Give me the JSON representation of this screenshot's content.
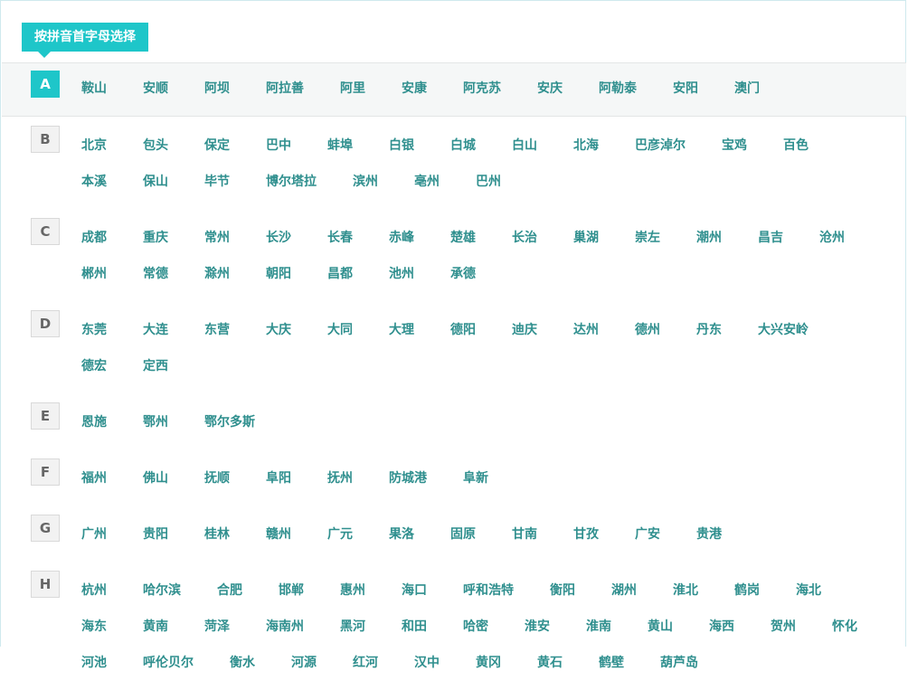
{
  "header": {
    "tab_label": "按拼音首字母选择"
  },
  "groups": [
    {
      "letter": "A",
      "active": true,
      "cities": [
        "鞍山",
        "安顺",
        "阿坝",
        "阿拉善",
        "阿里",
        "安康",
        "阿克苏",
        "安庆",
        "阿勒泰",
        "安阳",
        "澳门"
      ]
    },
    {
      "letter": "B",
      "active": false,
      "cities": [
        "北京",
        "包头",
        "保定",
        "巴中",
        "蚌埠",
        "白银",
        "白城",
        "白山",
        "北海",
        "巴彦淖尔",
        "宝鸡",
        "百色",
        "本溪",
        "保山",
        "毕节",
        "博尔塔拉",
        "滨州",
        "亳州",
        "巴州"
      ]
    },
    {
      "letter": "C",
      "active": false,
      "cities": [
        "成都",
        "重庆",
        "常州",
        "长沙",
        "长春",
        "赤峰",
        "楚雄",
        "长治",
        "巢湖",
        "崇左",
        "潮州",
        "昌吉",
        "沧州",
        "郴州",
        "常德",
        "滁州",
        "朝阳",
        "昌都",
        "池州",
        "承德"
      ]
    },
    {
      "letter": "D",
      "active": false,
      "cities": [
        "东莞",
        "大连",
        "东营",
        "大庆",
        "大同",
        "大理",
        "德阳",
        "迪庆",
        "达州",
        "德州",
        "丹东",
        "大兴安岭",
        "德宏",
        "定西"
      ]
    },
    {
      "letter": "E",
      "active": false,
      "cities": [
        "恩施",
        "鄂州",
        "鄂尔多斯"
      ]
    },
    {
      "letter": "F",
      "active": false,
      "cities": [
        "福州",
        "佛山",
        "抚顺",
        "阜阳",
        "抚州",
        "防城港",
        "阜新"
      ]
    },
    {
      "letter": "G",
      "active": false,
      "cities": [
        "广州",
        "贵阳",
        "桂林",
        "赣州",
        "广元",
        "果洛",
        "固原",
        "甘南",
        "甘孜",
        "广安",
        "贵港"
      ]
    },
    {
      "letter": "H",
      "active": false,
      "cities": [
        "杭州",
        "哈尔滨",
        "合肥",
        "邯郸",
        "惠州",
        "海口",
        "呼和浩特",
        "衡阳",
        "湖州",
        "淮北",
        "鹤岗",
        "海北",
        "海东",
        "黄南",
        "菏泽",
        "海南州",
        "黑河",
        "和田",
        "哈密",
        "淮安",
        "淮南",
        "黄山",
        "海西",
        "贺州",
        "怀化",
        "河池",
        "呼伦贝尔",
        "衡水",
        "河源",
        "红河",
        "汉中",
        "黄冈",
        "黄石",
        "鹤壁",
        "葫芦岛"
      ]
    }
  ]
}
